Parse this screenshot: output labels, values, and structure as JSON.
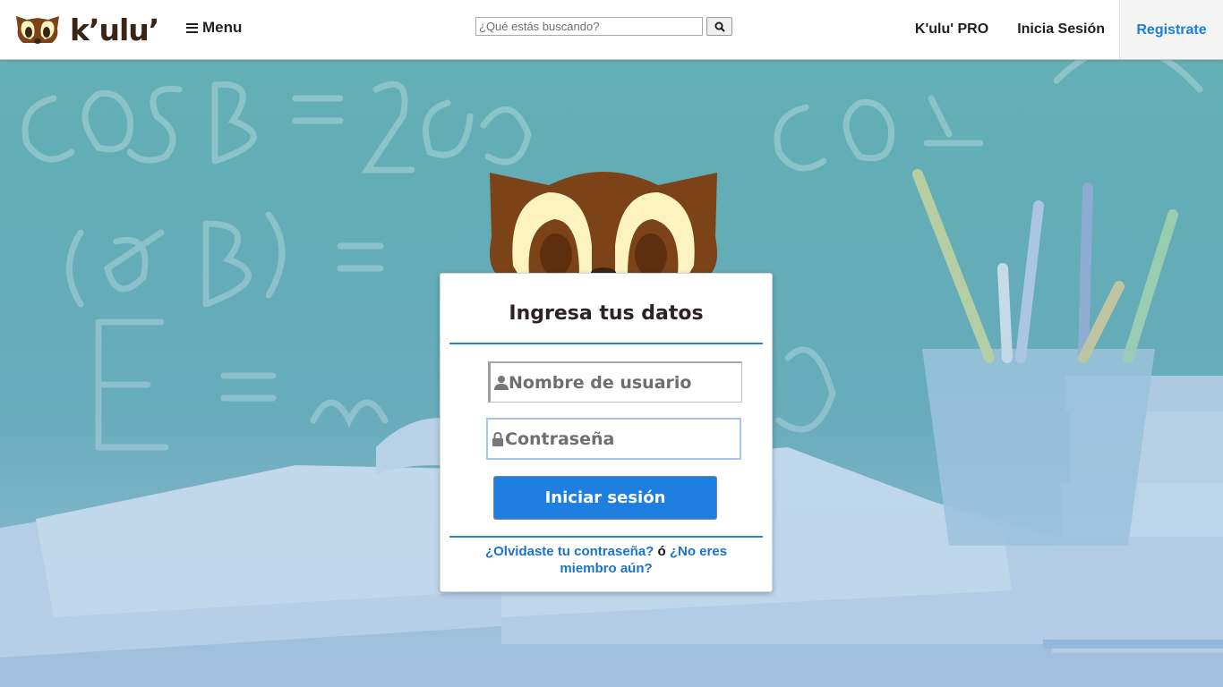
{
  "brand": {
    "name": "k’ulu’",
    "logo_icon": "raccoon-logo-icon"
  },
  "nav": {
    "menu_label": "Menu",
    "search_placeholder": "¿Qué estás buscando?",
    "search_icon": "search-icon",
    "pro_label": "K'ulu' PRO",
    "login_label": "Inicia Sesión",
    "register_label": "Registrate"
  },
  "login": {
    "title": "Ingresa tus datos",
    "username_placeholder": "Nombre de usuario",
    "password_placeholder": "Contraseña",
    "submit_label": "Iniciar sesión",
    "forgot_link": "¿Olvidaste tu contraseña?",
    "separator": " ó ",
    "signup_link": "¿No eres miembro aún?"
  },
  "colors": {
    "accent": "#1f7fe0",
    "link": "#1a73c8",
    "mascot_brown": "#7b4317",
    "mascot_cream": "#fdf3c0",
    "background_overlay": "#6fb1c7"
  }
}
